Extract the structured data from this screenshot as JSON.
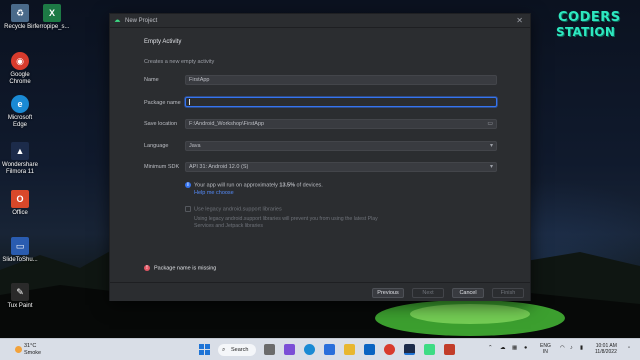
{
  "desktop": {
    "icons": [
      {
        "name": "Recycle Bin",
        "glyph": "♻",
        "color": "#4a6a8a"
      },
      {
        "name": "ferropipe_s...",
        "glyph": "X",
        "color": "#1d7a45"
      },
      {
        "name": "Google Chrome",
        "glyph": "◉",
        "color": "#d83b2d"
      },
      {
        "name": "Microsoft Edge",
        "glyph": "e",
        "color": "#1a8ad4"
      },
      {
        "name": "Wondershare Filmora 11",
        "glyph": "▲",
        "color": "#1c2b4a"
      },
      {
        "name": "Office",
        "glyph": "O",
        "color": "#d8482a"
      },
      {
        "name": "SlideToShu...",
        "glyph": "▭",
        "color": "#2a5cb0"
      },
      {
        "name": "Tux Paint",
        "glyph": "🐧",
        "color": "#2a2a2a"
      }
    ],
    "logo_line1": "CODERS",
    "logo_line2": "STATION"
  },
  "dialog": {
    "title": "New Project",
    "heading": "Empty Activity",
    "description": "Creates a new empty activity",
    "fields": {
      "name": {
        "label": "Name",
        "value": "FirstApp"
      },
      "package": {
        "label": "Package name",
        "value": ""
      },
      "save_location": {
        "label": "Save location",
        "value": "F:\\Android_Workshop\\FirstApp"
      },
      "language": {
        "label": "Language",
        "value": "Java"
      },
      "min_sdk": {
        "label": "Minimum SDK",
        "value": "API 31: Android 12.0 (S)"
      }
    },
    "info_prefix": "Your app will run on approximately ",
    "info_percent": "13.5%",
    "info_suffix": " of devices.",
    "help_link": "Help me choose",
    "legacy_label": "Use legacy android.support libraries",
    "legacy_desc": "Using legacy android.support libraries will prevent you from using the latest Play Services and Jetpack libraries",
    "error": "Package name is missing",
    "buttons": {
      "previous": "Previous",
      "next": "Next",
      "cancel": "Cancel",
      "finish": "Finish"
    }
  },
  "taskbar": {
    "weather_temp": "31°C",
    "weather_text": "Smoke",
    "search": "Search",
    "lang_1": "ENG",
    "lang_2": "IN",
    "time": "10:01 AM",
    "date": "11/8/2022"
  }
}
